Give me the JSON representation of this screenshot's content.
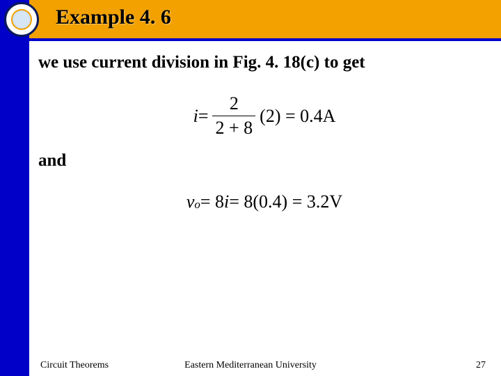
{
  "header": {
    "title": "Example 4. 6"
  },
  "body": {
    "lead": "we use current division in Fig. 4. 18(c) to get",
    "eq1": {
      "lhs_var": "i",
      "eq": " = ",
      "frac_num": "2",
      "frac_den": "2 + 8",
      "mult": "(2) = 0.4",
      "unit": "A"
    },
    "and": "and",
    "eq2": {
      "lhs_var": "v",
      "lhs_sub": "o",
      "rhs": " = 8",
      "rhs_var": "i",
      "rest": " = 8(0.4) = 3.2",
      "unit": "V"
    }
  },
  "footer": {
    "left": "Circuit Theorems",
    "center": "Eastern Mediterranean University",
    "page": "27"
  }
}
